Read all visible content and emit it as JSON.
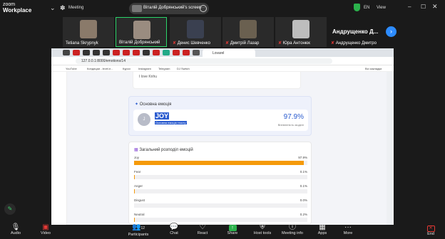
{
  "app": {
    "logo_line1": "zoom",
    "logo_line2": "Workplace",
    "meeting_label": "Meeting"
  },
  "share": {
    "label": "Віталій Добрянський's screen"
  },
  "topbar": {
    "lang": "EN",
    "view": "View"
  },
  "participants": [
    {
      "name": "Tetiana Skrypnyk",
      "muted": false
    },
    {
      "name": "Віталій Добрянський",
      "muted": false
    },
    {
      "name": "Денис Шевченко",
      "muted": true
    },
    {
      "name": "Дмитрій Лазар",
      "muted": true
    },
    {
      "name": "Юра Антонюк",
      "muted": true
    },
    {
      "name": "Андрущенко Дмитро",
      "muted": true
    }
  ],
  "big_name": "Андрущенко Д...",
  "browser": {
    "tab_title": "Lovarel",
    "url": "127.0.0.1:8000/emotions/14",
    "bookmarks": [
      "YouTube",
      "Кондиции - level.e...",
      "Курси",
      "Instagram",
      "Telegram",
      "DJ Switch"
    ],
    "all_bookmarks": "Всі закладки"
  },
  "page": {
    "top_text": "I love Knhu",
    "emotion_card": {
      "title": "Основна емоція",
      "avatar_letter": "J",
      "emotion": "JOY",
      "subtitle": "Основна емоція тексту",
      "percent": "97.9%",
      "percent_label": "Впевненість моделі"
    },
    "distribution": {
      "title": "Загальний розподіл емоцій",
      "rows": [
        {
          "label": "Joy",
          "value": "97.9%",
          "fraction": 0.979
        },
        {
          "label": "Fear",
          "value": "0.1%",
          "fraction": 0.001
        },
        {
          "label": "Anger",
          "value": "0.1%",
          "fraction": 0.001
        },
        {
          "label": "Disgust",
          "value": "0.0%",
          "fraction": 0.0
        },
        {
          "label": "Neutral",
          "value": "0.2%",
          "fraction": 0.002
        }
      ]
    }
  },
  "toolbar": {
    "audio": "Audio",
    "video": "Video",
    "participants": "Participants",
    "participants_count": "12",
    "chat": "Chat",
    "react": "React",
    "share": "Share",
    "host_tools": "Host tools",
    "meeting_info": "Meeting info",
    "apps": "Apps",
    "more": "More",
    "end": "End"
  }
}
